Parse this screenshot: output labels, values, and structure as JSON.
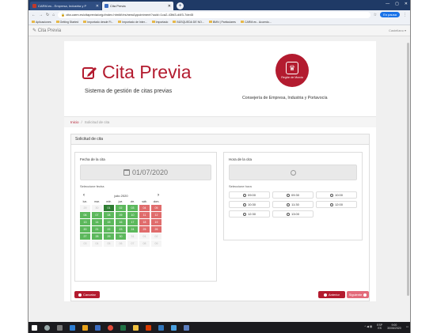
{
  "browser": {
    "tabs": [
      {
        "label": "CARM.es - Empresa, Industria y P"
      },
      {
        "label": "Cita Previa"
      }
    ],
    "url": "cita.carm.es/citaprevia/cejp/index.html#!/es/newAppointment?uuid=1ca2-43fd3-d4f3-7de45",
    "incognito_label": "En pausa",
    "bookmarks": [
      "Aplicaciones",
      "Getting Started",
      "Importado desde Fi...",
      "Importado de Inter...",
      "Importado",
      "BÚSQUEDA DE NO...",
      "BMN | Particulares",
      "CARM.es - Acuerdo..."
    ]
  },
  "app": {
    "header_title": "Cita Previa",
    "language": "Castellano"
  },
  "banner": {
    "title": "Cita Previa",
    "subtitle": "Sistema de gestión de citas previas",
    "seal_text": "Región de Murcia",
    "consejeria": "Consejería de Empresa, Industria y Portavocía"
  },
  "breadcrumb": {
    "home": "Inicio",
    "separator": "/",
    "current": "Solicitud de cita"
  },
  "form": {
    "panel_title": "Solicitud de cita",
    "date_label": "Fecha de la cita",
    "date_value": "01/07/2020",
    "select_date_label": "Seleccione fecha",
    "calendar": {
      "month": "julio 2020",
      "prev": "‹",
      "next": "›",
      "weekdays": [
        "lun.",
        "mar.",
        "mié.",
        "jue.",
        "vie.",
        "sáb.",
        "dom."
      ],
      "days": [
        {
          "n": "29",
          "s": "o"
        },
        {
          "n": "30",
          "s": "o"
        },
        {
          "n": "01",
          "s": "dg"
        },
        {
          "n": "02",
          "s": "g"
        },
        {
          "n": "03",
          "s": "g"
        },
        {
          "n": "04",
          "s": "r"
        },
        {
          "n": "05",
          "s": "r"
        },
        {
          "n": "06",
          "s": "g"
        },
        {
          "n": "07",
          "s": "g"
        },
        {
          "n": "08",
          "s": "g"
        },
        {
          "n": "09",
          "s": "g"
        },
        {
          "n": "10",
          "s": "g"
        },
        {
          "n": "11",
          "s": "r"
        },
        {
          "n": "12",
          "s": "r"
        },
        {
          "n": "13",
          "s": "g"
        },
        {
          "n": "14",
          "s": "g"
        },
        {
          "n": "15",
          "s": "g"
        },
        {
          "n": "16",
          "s": "g"
        },
        {
          "n": "17",
          "s": "g"
        },
        {
          "n": "18",
          "s": "r"
        },
        {
          "n": "19",
          "s": "r"
        },
        {
          "n": "20",
          "s": "g"
        },
        {
          "n": "21",
          "s": "g"
        },
        {
          "n": "22",
          "s": "g"
        },
        {
          "n": "23",
          "s": "g"
        },
        {
          "n": "24",
          "s": "g"
        },
        {
          "n": "25",
          "s": "r"
        },
        {
          "n": "26",
          "s": "r"
        },
        {
          "n": "27",
          "s": "g"
        },
        {
          "n": "28",
          "s": "g"
        },
        {
          "n": "29",
          "s": "g"
        },
        {
          "n": "30",
          "s": "g"
        },
        {
          "n": "31",
          "s": "o"
        },
        {
          "n": "01",
          "s": "o"
        },
        {
          "n": "02",
          "s": "o"
        },
        {
          "n": "03",
          "s": "o"
        },
        {
          "n": "04",
          "s": "o"
        },
        {
          "n": "05",
          "s": "o"
        },
        {
          "n": "06",
          "s": "o"
        },
        {
          "n": "07",
          "s": "o"
        },
        {
          "n": "08",
          "s": "o"
        },
        {
          "n": "09",
          "s": "o"
        }
      ]
    },
    "time_label": "Hora de la cita",
    "select_time_label": "Seleccione hora",
    "time_slots": [
      "09:00",
      "09:30",
      "10:00",
      "10:30",
      "11:30",
      "12:00",
      "12:30",
      "13:00"
    ],
    "cancel_label": "Cancelar",
    "prev_label": "Anterior",
    "next_label": "Siguiente"
  },
  "taskbar": {
    "lang": "ESP",
    "lang2": "ES",
    "time": "9:00",
    "date": "30/06/2020"
  },
  "colors": {
    "brand": "#b31b2f",
    "available": "#5cb85c",
    "selected": "#2e7d32",
    "unavailable": "#e06c6c"
  }
}
